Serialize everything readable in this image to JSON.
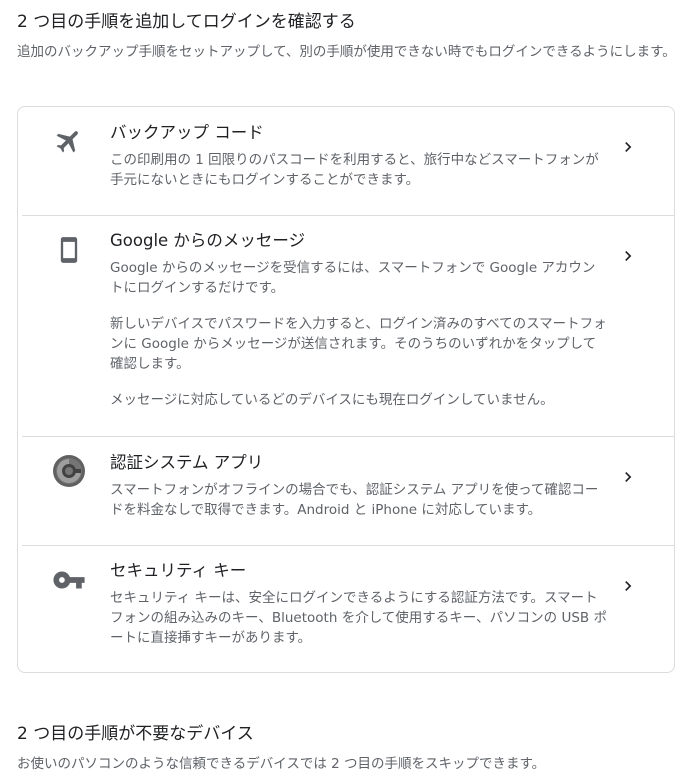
{
  "section1": {
    "title": "2 つ目の手順を追加してログインを確認する",
    "description": "追加のバックアップ手順をセットアップして、別の手順が使用できない時でもログインできるようにします。"
  },
  "options": [
    {
      "icon": "airplane-icon",
      "title": "バックアップ コード",
      "paragraphs": [
        "この印刷用の 1 回限りのパスコードを利用すると、旅行中などスマートフォンが手元にないときにもログインすることができます。"
      ]
    },
    {
      "icon": "smartphone-icon",
      "title": "Google からのメッセージ",
      "paragraphs": [
        "Google からのメッセージを受信するには、スマートフォンで Google アカウントにログインするだけです。",
        "新しいデバイスでパスワードを入力すると、ログイン済みのすべてのスマートフォンに Google からメッセージが送信されます。そのうちのいずれかをタップして確認します。",
        "メッセージに対応しているどのデバイスにも現在ログインしていません。"
      ]
    },
    {
      "icon": "authenticator-icon",
      "title": "認証システム アプリ",
      "paragraphs": [
        "スマートフォンがオフラインの場合でも、認証システム アプリを使って確認コードを料金なしで取得できます。Android と iPhone に対応しています。"
      ]
    },
    {
      "icon": "key-icon",
      "title": "セキュリティ キー",
      "paragraphs": [
        "セキュリティ キーは、安全にログインできるようにする認証方法です。スマートフォンの組み込みのキー、Bluetooth を介して使用するキー、パソコンの USB ポートに直接挿すキーがあります。"
      ]
    }
  ],
  "section2": {
    "title": "2 つ目の手順が不要なデバイス",
    "description": "お使いのパソコンのような信頼できるデバイスでは 2 つ目の手順をスキップできます。"
  },
  "colors": {
    "title_text": "#202124",
    "secondary_text": "#5f6368",
    "icon_gray": "#5f6368",
    "divider": "#dadce0"
  }
}
